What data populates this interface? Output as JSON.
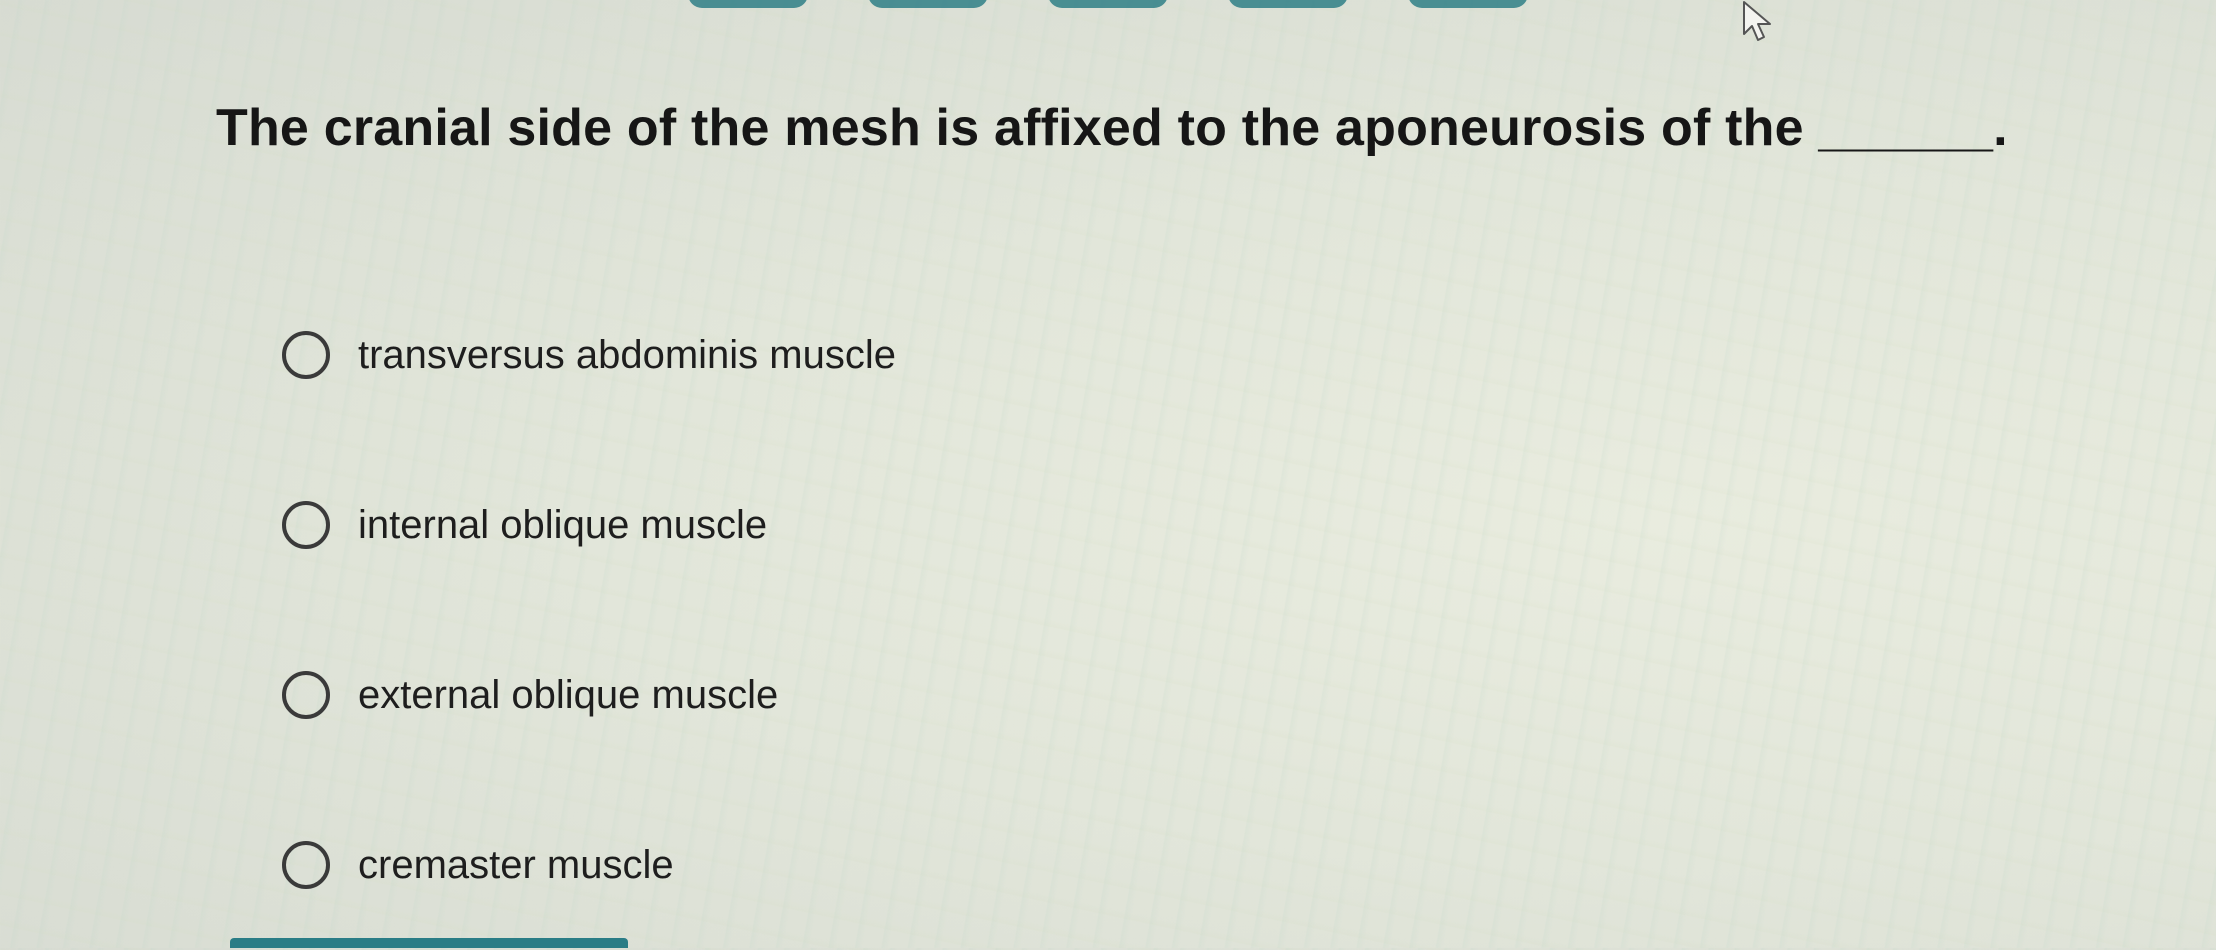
{
  "question": {
    "text": "The cranial side of the mesh is affixed to the aponeurosis of the ______."
  },
  "options": [
    {
      "label": "transversus abdominis muscle",
      "selected": false
    },
    {
      "label": "internal oblique muscle",
      "selected": false
    },
    {
      "label": "external oblique muscle",
      "selected": false
    },
    {
      "label": "cremaster muscle",
      "selected": false
    }
  ],
  "colors": {
    "accent": "#2a7d86",
    "text": "#161616",
    "radio_border": "#3a3a3a"
  },
  "icons": {
    "cursor": "mouse-pointer-icon",
    "radio": "radio-unchecked-icon"
  }
}
